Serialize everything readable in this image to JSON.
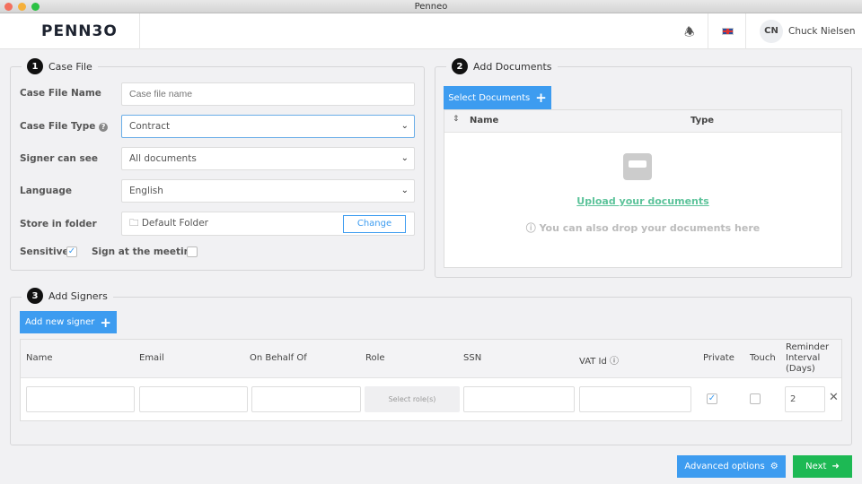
{
  "window": {
    "title": "Penneo"
  },
  "header": {
    "logo": "PENN3O",
    "user_initials": "CN",
    "user_name": "Chuck Nielsen"
  },
  "case_file": {
    "step": "1",
    "title": "Case File",
    "name_label": "Case File Name",
    "name_placeholder": "Case file name",
    "type_label": "Case File Type",
    "type_value": "Contract",
    "signer_label": "Signer can see",
    "signer_value": "All documents",
    "language_label": "Language",
    "language_value": "English",
    "folder_label": "Store in folder",
    "folder_value": "Default Folder",
    "change_label": "Change",
    "sensitive_label": "Sensitive",
    "sensitive_checked": true,
    "meeting_label": "Sign at the meeting",
    "meeting_checked": false
  },
  "documents": {
    "step": "2",
    "title": "Add Documents",
    "select_label": "Select Documents",
    "columns": [
      "Name",
      "Type"
    ],
    "upload_link": "Upload your documents",
    "drop_hint": "You can also drop your documents here"
  },
  "signers": {
    "step": "3",
    "title": "Add Signers",
    "add_label": "Add new signer",
    "columns": [
      "Name",
      "Email",
      "On Behalf Of",
      "Role",
      "SSN",
      "VAT Id",
      "Private",
      "Touch",
      "Reminder Interval (Days)"
    ],
    "row": {
      "role_placeholder": "Select role(s)",
      "private": true,
      "touch": false,
      "reminder": "2"
    }
  },
  "footer": {
    "advanced_label": "Advanced options",
    "next_label": "Next"
  },
  "colors": {
    "accent": "#3d9cf0",
    "success": "#1db954",
    "link": "#5cc39a"
  }
}
